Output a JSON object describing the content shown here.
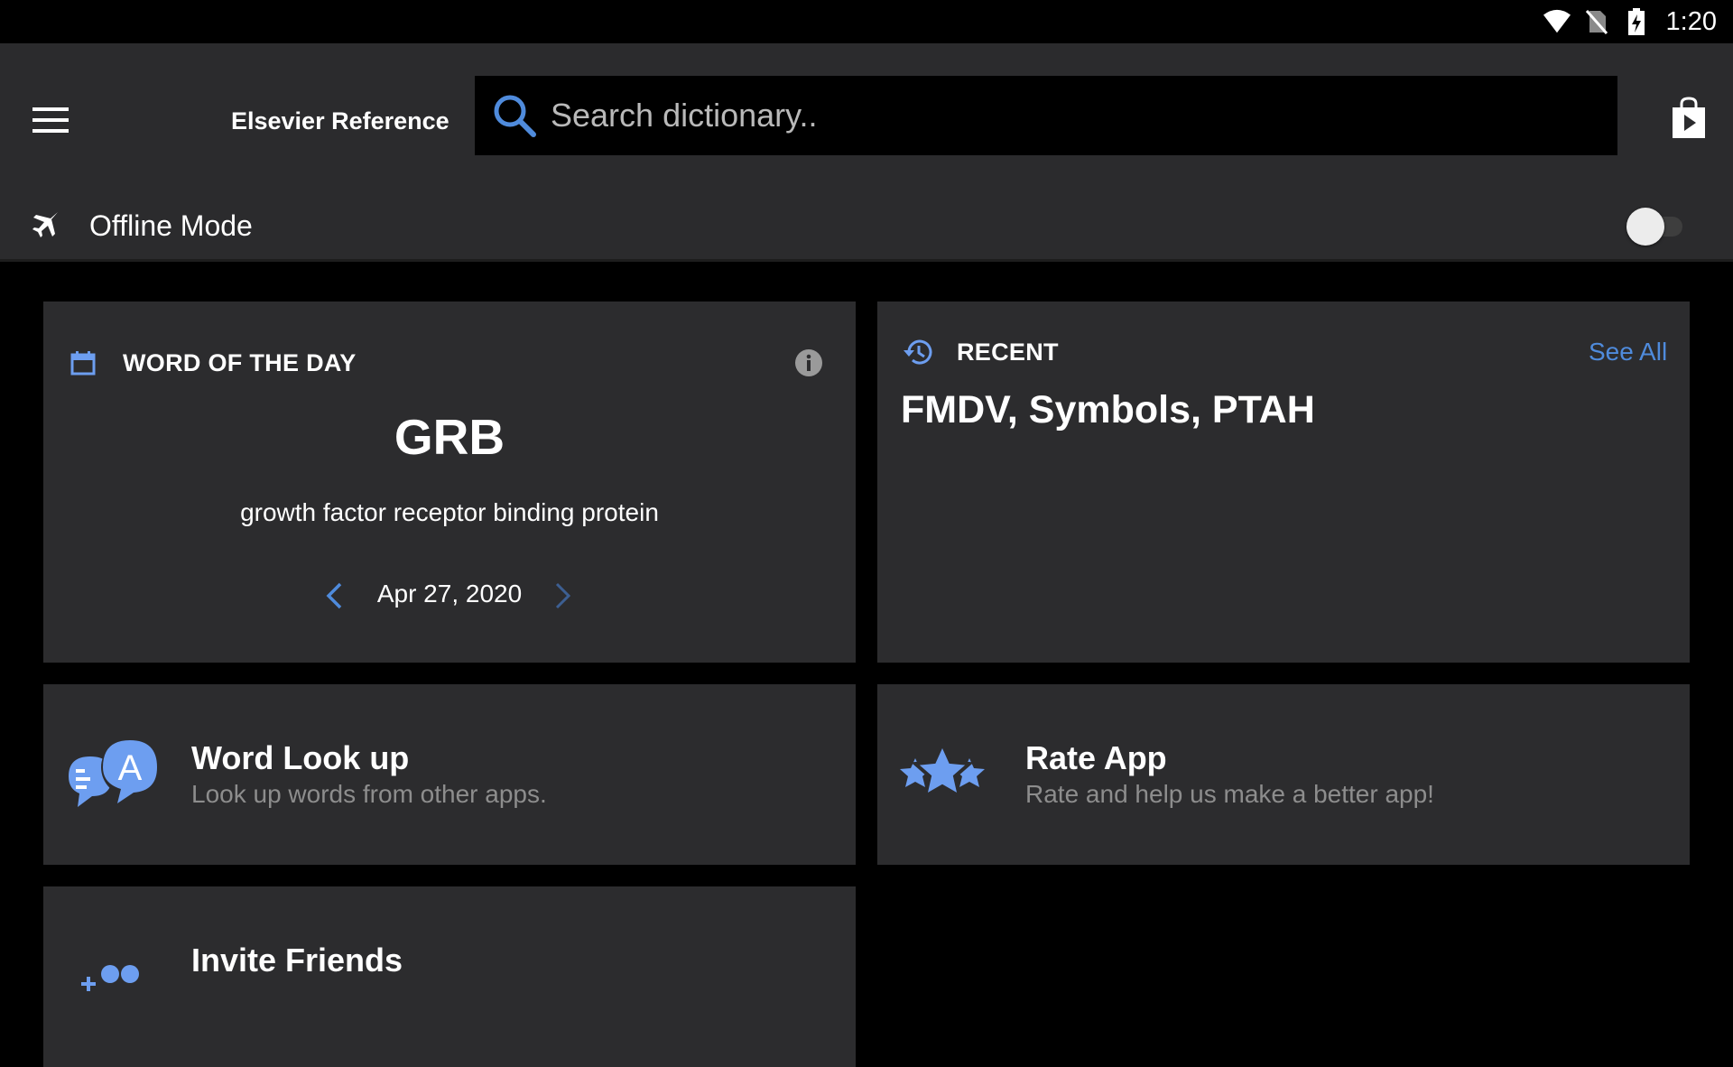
{
  "status_bar": {
    "time": "1:20"
  },
  "app_bar": {
    "title": "Elsevier Reference",
    "search_placeholder": "Search dictionary.."
  },
  "offline": {
    "label": "Offline Mode",
    "enabled": false
  },
  "word_of_the_day": {
    "header": "WORD OF THE DAY",
    "word": "GRB",
    "definition": "growth factor receptor binding protein",
    "date": "Apr 27, 2020"
  },
  "recent": {
    "header": "RECENT",
    "see_all": "See All",
    "words": "FMDV, Symbols, PTAH"
  },
  "actions": [
    {
      "title": "Word Look up",
      "subtitle": "Look up words from other apps.",
      "icon": "chat-bubbles-icon"
    },
    {
      "title": "Rate App",
      "subtitle": "Rate and help us make a better app!",
      "icon": "stars-icon"
    },
    {
      "title": "Invite Friends",
      "subtitle": "",
      "icon": "add-people-icon"
    }
  ],
  "colors": {
    "accent": "#4f8bdc",
    "icon_blue": "#6d9ef0",
    "card_bg": "#2c2c2e",
    "appbar_bg": "#2b2b2d",
    "background": "#000000"
  }
}
